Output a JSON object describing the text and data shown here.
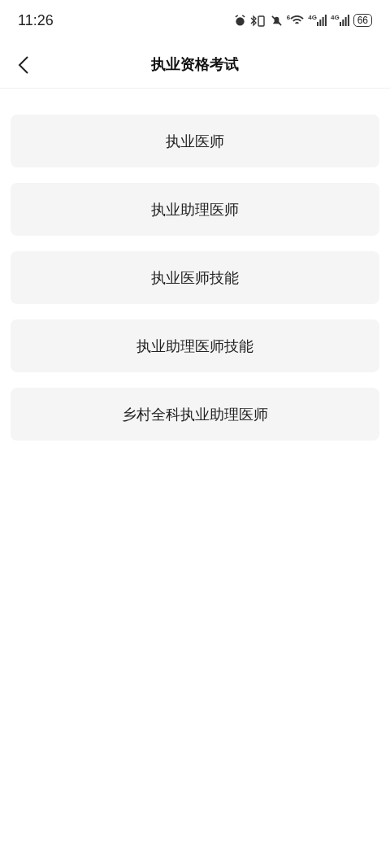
{
  "status_bar": {
    "time": "11:26",
    "wifi_label": "6",
    "signal_labels": [
      "4G",
      "4G"
    ],
    "battery": "66"
  },
  "header": {
    "title": "执业资格考试"
  },
  "options": [
    {
      "label": "执业医师"
    },
    {
      "label": "执业助理医师"
    },
    {
      "label": "执业医师技能"
    },
    {
      "label": "执业助理医师技能"
    },
    {
      "label": "乡村全科执业助理医师"
    }
  ]
}
